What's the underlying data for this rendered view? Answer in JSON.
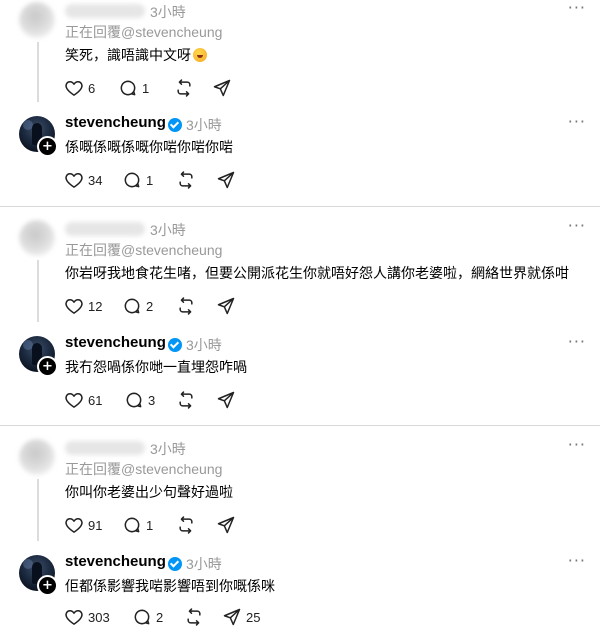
{
  "threads": [
    {
      "reply": {
        "time": "3小時",
        "replying_to": "正在回覆@stevencheung",
        "text": "笑死，識唔識中文呀",
        "emoji": "rofl-emoji",
        "likes": "6",
        "comments": "1",
        "reposts": "",
        "shares": ""
      },
      "author": {
        "username": "stevencheung",
        "time": "3小時",
        "text": "係嘅係嘅係嘅你啱你啱你啱",
        "likes": "34",
        "comments": "1",
        "reposts": "",
        "shares": ""
      }
    },
    {
      "reply": {
        "time": "3小時",
        "replying_to": "正在回覆@stevencheung",
        "text": "你岩呀我地食花生啫，但要公開派花生你就唔好怨人講你老婆啦，網絡世界就係咁",
        "likes": "12",
        "comments": "2",
        "reposts": "",
        "shares": ""
      },
      "author": {
        "username": "stevencheung",
        "time": "3小時",
        "text": "我冇怨喎係你哋一直埋怨咋喎",
        "likes": "61",
        "comments": "3",
        "reposts": "",
        "shares": ""
      }
    },
    {
      "reply": {
        "time": "3小時",
        "replying_to": "正在回覆@stevencheung",
        "text": "你叫你老婆出少句聲好過啦",
        "likes": "91",
        "comments": "1",
        "reposts": "",
        "shares": ""
      },
      "author": {
        "username": "stevencheung",
        "time": "3小時",
        "text": "佢都係影響我啱影響唔到你嘅係咪",
        "likes": "303",
        "comments": "2",
        "reposts": "",
        "shares": "25"
      }
    }
  ],
  "icons": {
    "like": "heart-icon",
    "comment": "comment-icon",
    "repost": "repost-icon",
    "share": "share-icon",
    "more": "more-icon",
    "verified": "verified-badge-icon"
  },
  "colors": {
    "verified": "#0095f6",
    "muted_text": "#999999",
    "separator": "#d9d9d9"
  }
}
